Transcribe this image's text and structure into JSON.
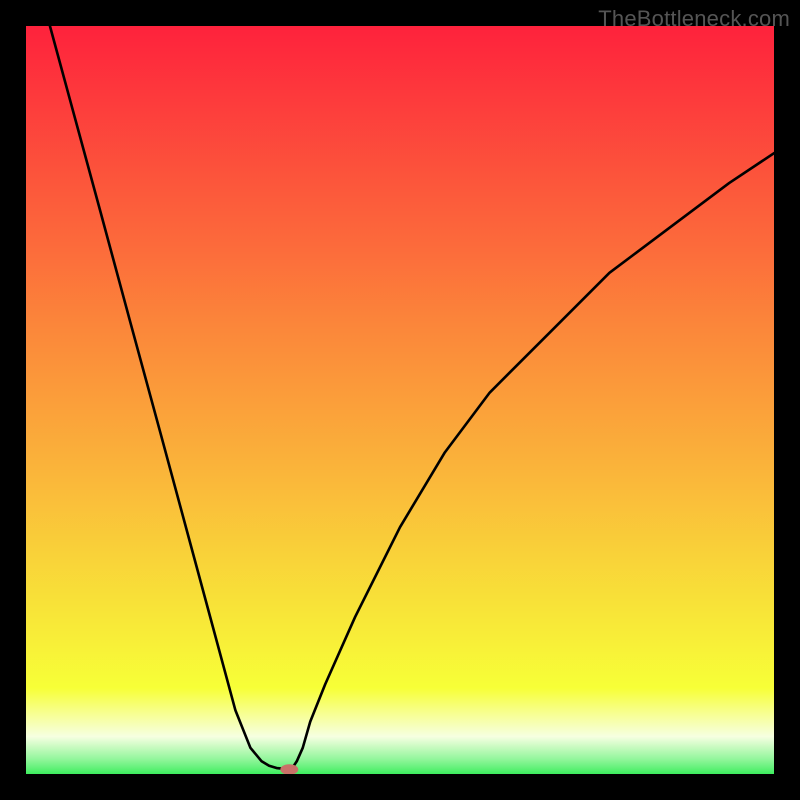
{
  "watermark": "TheBottleneck.com",
  "chart_data": {
    "type": "line",
    "title": "",
    "xlabel": "",
    "ylabel": "",
    "xlim": [
      0,
      100
    ],
    "ylim": [
      0,
      100
    ],
    "x": [
      3.2,
      6,
      10,
      14,
      18,
      22,
      25,
      28,
      30,
      31.5,
      32.5,
      33.5,
      34.5,
      35.1,
      35.5,
      35.8,
      36.2,
      37,
      38,
      40,
      44,
      50,
      56,
      62,
      70,
      78,
      86,
      94,
      100
    ],
    "y": [
      100,
      89.7,
      75,
      60.2,
      45.5,
      30.7,
      19.6,
      8.5,
      3.5,
      1.7,
      1.1,
      0.8,
      0.7,
      0.7,
      0.8,
      1.1,
      1.7,
      3.5,
      7,
      12,
      21,
      33,
      43,
      51,
      59,
      67,
      73,
      79,
      83
    ],
    "marker": {
      "x": 35.2,
      "y": 0.6,
      "color": "#c97168",
      "rx": 1.2,
      "ry": 0.7
    },
    "gradient_stops": [
      {
        "offset": 0,
        "color": "#fe223c"
      },
      {
        "offset": 0.1,
        "color": "#fd3b3c"
      },
      {
        "offset": 0.2,
        "color": "#fc543b"
      },
      {
        "offset": 0.3,
        "color": "#fc6c3b"
      },
      {
        "offset": 0.4,
        "color": "#fb863a"
      },
      {
        "offset": 0.5,
        "color": "#fb9e3a"
      },
      {
        "offset": 0.6,
        "color": "#fab63a"
      },
      {
        "offset": 0.7,
        "color": "#f9d039"
      },
      {
        "offset": 0.8,
        "color": "#f8e938"
      },
      {
        "offset": 0.885,
        "color": "#f7ff37"
      },
      {
        "offset": 0.917,
        "color": "#f7ff8c"
      },
      {
        "offset": 0.95,
        "color": "#f6ffe1"
      },
      {
        "offset": 0.965,
        "color": "#c5fabe"
      },
      {
        "offset": 0.98,
        "color": "#93f69c"
      },
      {
        "offset": 0.992,
        "color": "#62f179"
      },
      {
        "offset": 1.0,
        "color": "#3dee5e"
      }
    ]
  }
}
